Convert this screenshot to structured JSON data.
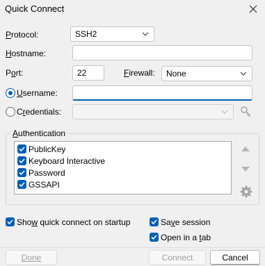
{
  "window": {
    "title": "Quick Connect"
  },
  "protocol": {
    "label": "Protocol:",
    "value": "SSH2"
  },
  "hostname": {
    "label": "Hostname:",
    "value": ""
  },
  "port": {
    "label": "Port:",
    "value": "22"
  },
  "firewall": {
    "label": "Firewall:",
    "value": "None"
  },
  "username": {
    "label": "Username:",
    "value": "",
    "selected": true
  },
  "credentials": {
    "label": "Credentials:",
    "value": "",
    "selected": false
  },
  "authentication": {
    "title": "Authentication",
    "methods": [
      {
        "label": "PublicKey",
        "checked": true
      },
      {
        "label": "Keyboard Interactive",
        "checked": true
      },
      {
        "label": "Password",
        "checked": true
      },
      {
        "label": "GSSAPI",
        "checked": true
      }
    ]
  },
  "options": {
    "show_on_startup": {
      "label": "Show quick connect on startup",
      "checked": true
    },
    "save_session": {
      "label": "Save session",
      "checked": true
    },
    "open_in_tab": {
      "label": "Open in a tab",
      "checked": true
    }
  },
  "buttons": {
    "done": "Done",
    "connect": "Connect",
    "cancel": "Cancel"
  },
  "colors": {
    "accent": "#005fb8",
    "background": "#f0f0f0"
  },
  "icons": [
    "close-icon",
    "chevron-down-icon",
    "key-icon",
    "arrow-up-icon",
    "arrow-down-icon",
    "gear-icon",
    "checkmark-icon"
  ]
}
